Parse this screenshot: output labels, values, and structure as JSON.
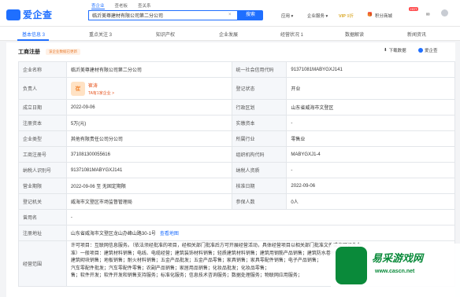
{
  "header": {
    "logo_text": "爱企查",
    "search_tabs": [
      "查企业",
      "查老板",
      "查关系"
    ],
    "search_value": "临沂美尊建材有限公司第二分公司",
    "search_clear": "×",
    "search_button": "搜索",
    "nav": {
      "app": "应用 ▾",
      "enterprise": "企业服务 ▾",
      "vip": "VIP",
      "vip_suffix": "9折",
      "points": "积分商城",
      "hot": "HOT"
    }
  },
  "tabs": [
    "基本信息 3",
    "重点关注 3",
    "知识产权",
    "企业发展",
    "经营状况 1",
    "数据解读",
    "新闻资讯"
  ],
  "panel": {
    "title": "工商注册",
    "badge": "该企业数据已更新",
    "download": "下载数据",
    "brand": "爱企查"
  },
  "registration": {
    "rows": [
      {
        "l1": "企业名称",
        "v1": "临沂美尊建材有限公司第二分公司",
        "l2": "统一社会信用代码",
        "v2": "91371081MABYGXJ141"
      },
      {
        "l1": "负责人",
        "rep_badge": "崔",
        "rep_name": "崔涛",
        "rep_sub": "TA有1家企业 >",
        "l2": "登记状态",
        "v2": "开业"
      },
      {
        "l1": "成立日期",
        "v1": "2022-09-06",
        "l2": "行政区划",
        "v2": "山东省威海市文登区"
      },
      {
        "l1": "注册资本",
        "v1": "5万(元)",
        "l2": "实缴资本",
        "v2": "-"
      },
      {
        "l1": "企业类型",
        "v1": "其他有限责任公司分公司",
        "l2": "所属行业",
        "v2": "零售业"
      },
      {
        "l1": "工商注册号",
        "v1": "371081300055616",
        "l2": "组织机构代码",
        "v2": "MABYGXJ1-4"
      },
      {
        "l1": "纳税人识别号",
        "v1": "91371081MABYGXJ141",
        "l2": "纳税人资质",
        "v2": "-"
      },
      {
        "l1": "营业期限",
        "v1": "2022-09-06 至 无固定期限",
        "l2": "核准日期",
        "v2": "2022-09-06"
      },
      {
        "l1": "登记机关",
        "v1": "威海市文登区市场监督管理局",
        "l2": "参保人数",
        "v2": "0人"
      }
    ],
    "former_name_label": "曾用名",
    "former_name": "-",
    "address_label": "注册地址",
    "address": "山东省威海市文登区龙山办峰山路30-1号",
    "map_link": "查看地图",
    "scope_label": "经营范围",
    "scope_lines": [
      "许可项目：互联网信息服务。（依法须经批准的项目，经相关部门批准后方可开展经营活动，具体经营项目以相关部门批准文件或许可证件为",
      "准）一般项目：建筑材料销售；电线、电缆经营；建筑装饰材料销售；轻质建筑材料销售；建筑用钢筋产品销售；建筑防水卷材产品销售；",
      "建筑砌块销售；地板销售；耐火材料销售；五金产品批发；五金产品零售；家具销售；家具零配件销售；电子产品销售；",
      "汽车零配件批发；汽车零配件零售；农副产品销售；家居用品销售；化妆品批发；化妆品零售；",
      "售；软件开发；软件开发和销售支持服务；标准化服务；信息技术咨询服务；数据处理服务；物联网应用服务；"
    ]
  },
  "watermark": {
    "title": "易采游戏网",
    "url": "www.cascn.net"
  }
}
